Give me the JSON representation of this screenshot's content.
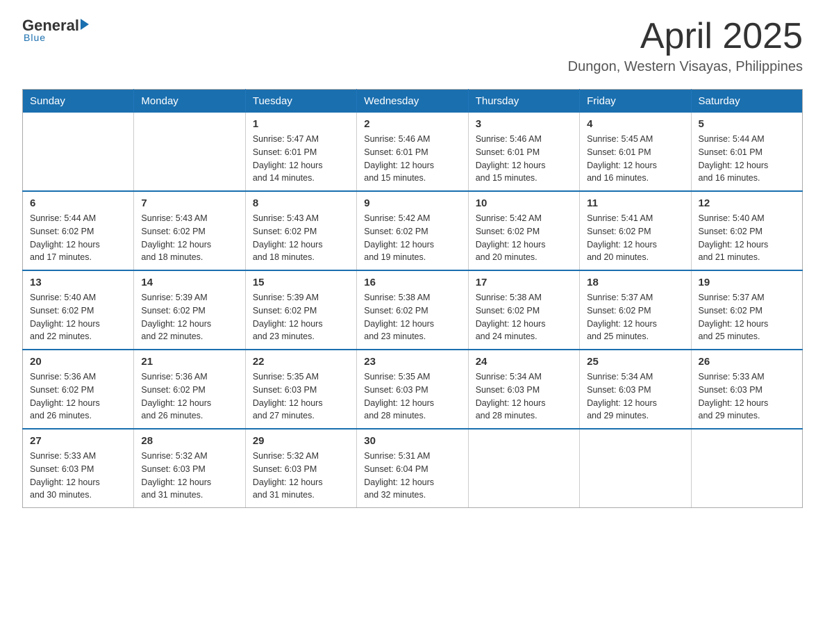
{
  "header": {
    "logo_general": "General",
    "logo_blue": "Blue",
    "month_title": "April 2025",
    "location": "Dungon, Western Visayas, Philippines"
  },
  "weekdays": [
    "Sunday",
    "Monday",
    "Tuesday",
    "Wednesday",
    "Thursday",
    "Friday",
    "Saturday"
  ],
  "weeks": [
    [
      {
        "day": "",
        "info": ""
      },
      {
        "day": "",
        "info": ""
      },
      {
        "day": "1",
        "info": "Sunrise: 5:47 AM\nSunset: 6:01 PM\nDaylight: 12 hours\nand 14 minutes."
      },
      {
        "day": "2",
        "info": "Sunrise: 5:46 AM\nSunset: 6:01 PM\nDaylight: 12 hours\nand 15 minutes."
      },
      {
        "day": "3",
        "info": "Sunrise: 5:46 AM\nSunset: 6:01 PM\nDaylight: 12 hours\nand 15 minutes."
      },
      {
        "day": "4",
        "info": "Sunrise: 5:45 AM\nSunset: 6:01 PM\nDaylight: 12 hours\nand 16 minutes."
      },
      {
        "day": "5",
        "info": "Sunrise: 5:44 AM\nSunset: 6:01 PM\nDaylight: 12 hours\nand 16 minutes."
      }
    ],
    [
      {
        "day": "6",
        "info": "Sunrise: 5:44 AM\nSunset: 6:02 PM\nDaylight: 12 hours\nand 17 minutes."
      },
      {
        "day": "7",
        "info": "Sunrise: 5:43 AM\nSunset: 6:02 PM\nDaylight: 12 hours\nand 18 minutes."
      },
      {
        "day": "8",
        "info": "Sunrise: 5:43 AM\nSunset: 6:02 PM\nDaylight: 12 hours\nand 18 minutes."
      },
      {
        "day": "9",
        "info": "Sunrise: 5:42 AM\nSunset: 6:02 PM\nDaylight: 12 hours\nand 19 minutes."
      },
      {
        "day": "10",
        "info": "Sunrise: 5:42 AM\nSunset: 6:02 PM\nDaylight: 12 hours\nand 20 minutes."
      },
      {
        "day": "11",
        "info": "Sunrise: 5:41 AM\nSunset: 6:02 PM\nDaylight: 12 hours\nand 20 minutes."
      },
      {
        "day": "12",
        "info": "Sunrise: 5:40 AM\nSunset: 6:02 PM\nDaylight: 12 hours\nand 21 minutes."
      }
    ],
    [
      {
        "day": "13",
        "info": "Sunrise: 5:40 AM\nSunset: 6:02 PM\nDaylight: 12 hours\nand 22 minutes."
      },
      {
        "day": "14",
        "info": "Sunrise: 5:39 AM\nSunset: 6:02 PM\nDaylight: 12 hours\nand 22 minutes."
      },
      {
        "day": "15",
        "info": "Sunrise: 5:39 AM\nSunset: 6:02 PM\nDaylight: 12 hours\nand 23 minutes."
      },
      {
        "day": "16",
        "info": "Sunrise: 5:38 AM\nSunset: 6:02 PM\nDaylight: 12 hours\nand 23 minutes."
      },
      {
        "day": "17",
        "info": "Sunrise: 5:38 AM\nSunset: 6:02 PM\nDaylight: 12 hours\nand 24 minutes."
      },
      {
        "day": "18",
        "info": "Sunrise: 5:37 AM\nSunset: 6:02 PM\nDaylight: 12 hours\nand 25 minutes."
      },
      {
        "day": "19",
        "info": "Sunrise: 5:37 AM\nSunset: 6:02 PM\nDaylight: 12 hours\nand 25 minutes."
      }
    ],
    [
      {
        "day": "20",
        "info": "Sunrise: 5:36 AM\nSunset: 6:02 PM\nDaylight: 12 hours\nand 26 minutes."
      },
      {
        "day": "21",
        "info": "Sunrise: 5:36 AM\nSunset: 6:02 PM\nDaylight: 12 hours\nand 26 minutes."
      },
      {
        "day": "22",
        "info": "Sunrise: 5:35 AM\nSunset: 6:03 PM\nDaylight: 12 hours\nand 27 minutes."
      },
      {
        "day": "23",
        "info": "Sunrise: 5:35 AM\nSunset: 6:03 PM\nDaylight: 12 hours\nand 28 minutes."
      },
      {
        "day": "24",
        "info": "Sunrise: 5:34 AM\nSunset: 6:03 PM\nDaylight: 12 hours\nand 28 minutes."
      },
      {
        "day": "25",
        "info": "Sunrise: 5:34 AM\nSunset: 6:03 PM\nDaylight: 12 hours\nand 29 minutes."
      },
      {
        "day": "26",
        "info": "Sunrise: 5:33 AM\nSunset: 6:03 PM\nDaylight: 12 hours\nand 29 minutes."
      }
    ],
    [
      {
        "day": "27",
        "info": "Sunrise: 5:33 AM\nSunset: 6:03 PM\nDaylight: 12 hours\nand 30 minutes."
      },
      {
        "day": "28",
        "info": "Sunrise: 5:32 AM\nSunset: 6:03 PM\nDaylight: 12 hours\nand 31 minutes."
      },
      {
        "day": "29",
        "info": "Sunrise: 5:32 AM\nSunset: 6:03 PM\nDaylight: 12 hours\nand 31 minutes."
      },
      {
        "day": "30",
        "info": "Sunrise: 5:31 AM\nSunset: 6:04 PM\nDaylight: 12 hours\nand 32 minutes."
      },
      {
        "day": "",
        "info": ""
      },
      {
        "day": "",
        "info": ""
      },
      {
        "day": "",
        "info": ""
      }
    ]
  ]
}
